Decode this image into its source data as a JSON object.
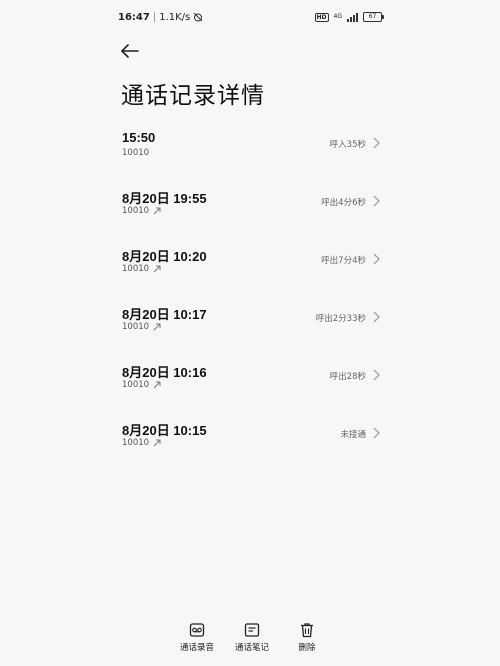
{
  "status_bar": {
    "time": "16:47",
    "separator": "|",
    "speed": "1.1K/s",
    "hd": "HD",
    "network_top": "4G",
    "battery": "67"
  },
  "header": {
    "title": "通话记录详情"
  },
  "calls": [
    {
      "title": "15:50",
      "number": "10010",
      "status": "呼入35秒",
      "direction": "incoming"
    },
    {
      "title": "8月20日 19:55",
      "number": "10010",
      "status": "呼出4分6秒",
      "direction": "outgoing"
    },
    {
      "title": "8月20日 10:20",
      "number": "10010",
      "status": "呼出7分4秒",
      "direction": "outgoing"
    },
    {
      "title": "8月20日 10:17",
      "number": "10010",
      "status": "呼出2分33秒",
      "direction": "outgoing"
    },
    {
      "title": "8月20日 10:16",
      "number": "10010",
      "status": "呼出28秒",
      "direction": "outgoing"
    },
    {
      "title": "8月20日 10:15",
      "number": "10010",
      "status": "未接通",
      "direction": "outgoing"
    }
  ],
  "toolbar": {
    "recording_label": "通话录音",
    "notes_label": "通话笔记",
    "delete_label": "删除"
  }
}
